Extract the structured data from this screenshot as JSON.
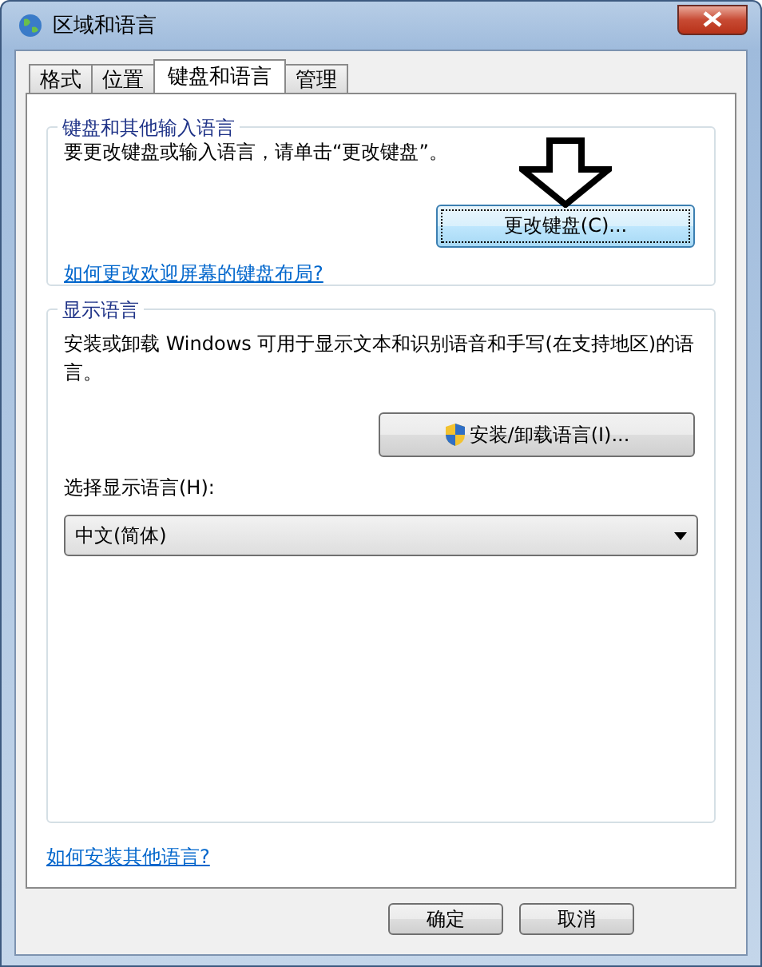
{
  "window": {
    "title": "区域和语言"
  },
  "tabs": [
    {
      "label": "格式",
      "selected": false
    },
    {
      "label": "位置",
      "selected": false
    },
    {
      "label": "键盘和语言",
      "selected": true
    },
    {
      "label": "管理",
      "selected": false
    }
  ],
  "keyboard_group": {
    "title": "键盘和其他输入语言",
    "text": "要更改键盘或输入语言，请单击“更改键盘”。",
    "button": "更改键盘(C)...",
    "link": "如何更改欢迎屏幕的键盘布局?"
  },
  "display_group": {
    "title": "显示语言",
    "text": "安装或卸载 Windows 可用于显示文本和识别语音和手写(在支持地区)的语言。",
    "button": "安装/卸载语言(I)...",
    "select_label": "选择显示语言(H):",
    "select_value": "中文(简体)"
  },
  "footer_link": "如何安装其他语言?",
  "buttons": [
    "确定",
    "取消"
  ]
}
